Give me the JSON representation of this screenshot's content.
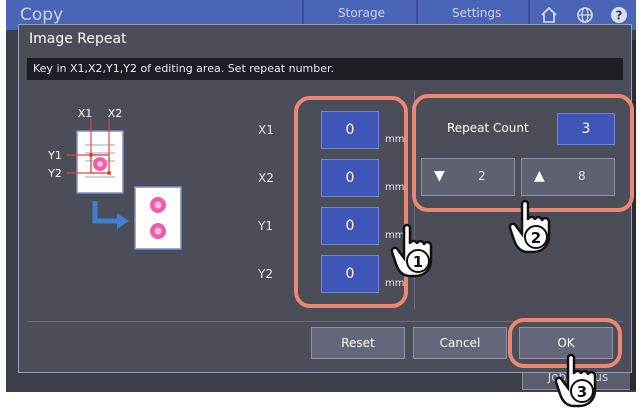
{
  "app": {
    "title": "Copy",
    "tabs": [
      "Storage",
      "Settings"
    ],
    "bottom_button": "Job Status"
  },
  "dialog": {
    "title": "Image Repeat",
    "message": "Key in X1,X2,Y1,Y2 of editing area. Set repeat number.",
    "fields": [
      {
        "label": "X1",
        "value": "0",
        "unit": "mm"
      },
      {
        "label": "X2",
        "value": "0",
        "unit": "mm"
      },
      {
        "label": "Y1",
        "value": "0",
        "unit": "mm"
      },
      {
        "label": "Y2",
        "value": "0",
        "unit": "mm"
      }
    ],
    "repeat": {
      "label": "Repeat Count",
      "value": "3",
      "down_value": "2",
      "up_value": "8"
    },
    "buttons": {
      "reset": "Reset",
      "cancel": "Cancel",
      "ok": "OK"
    },
    "diagram_labels": [
      "X1",
      "X2",
      "Y1",
      "Y2"
    ]
  },
  "callouts": [
    "1",
    "2",
    "3"
  ],
  "colors": {
    "accent_input": "#4055b8",
    "callout": "#ec8772"
  }
}
